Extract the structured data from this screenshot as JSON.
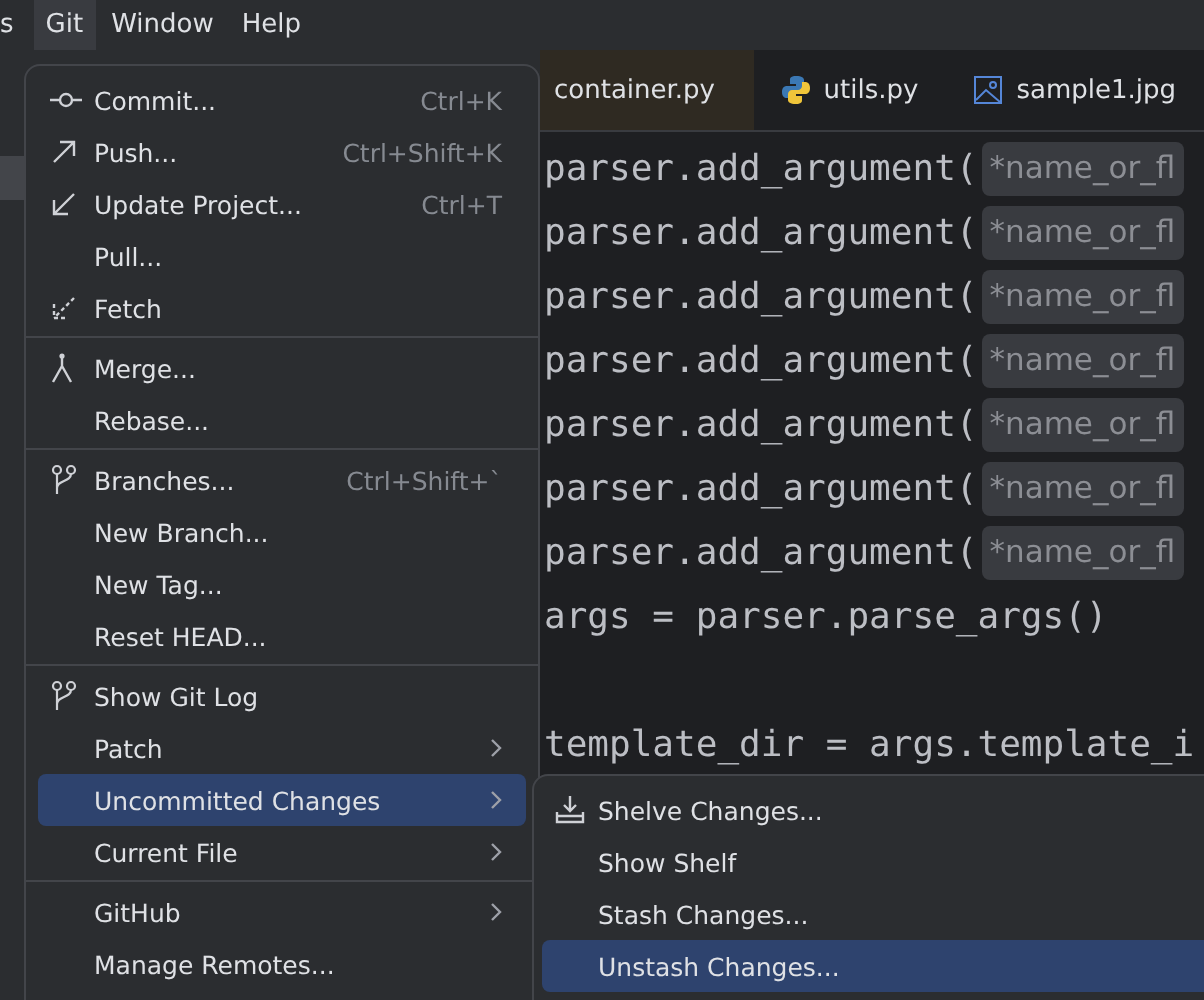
{
  "menubar": [
    {
      "label": "s",
      "selected": false
    },
    {
      "label": "Git",
      "selected": true
    },
    {
      "label": "Window",
      "selected": false
    },
    {
      "label": "Help",
      "selected": false
    }
  ],
  "tabs": [
    {
      "label": "container.py",
      "selected": true
    },
    {
      "label": "utils.py",
      "selected": false
    },
    {
      "label": "sample1.jpg",
      "selected": false
    }
  ],
  "code_blocks": [
    [
      {
        "code": "parser.add_argument(",
        "hint": "*name_or_fl"
      },
      {
        "code": "parser.add_argument(",
        "hint": "*name_or_fl"
      },
      {
        "code": "parser.add_argument(",
        "hint": "*name_or_fl"
      },
      {
        "code": "parser.add_argument(",
        "hint": "*name_or_fl"
      },
      {
        "code": "parser.add_argument(",
        "hint": "*name_or_fl"
      },
      {
        "code": "parser.add_argument(",
        "hint": "*name_or_fl"
      },
      {
        "code": "parser.add_argument(",
        "hint": "*name_or_fl"
      },
      {
        "code": "args = parser.parse_args()"
      }
    ],
    [
      {
        "code": "template_dir = args.template_i"
      }
    ]
  ],
  "git_menu": {
    "groups": [
      [
        {
          "label": "Commit...",
          "shortcut": "Ctrl+K",
          "submenu": false,
          "selected": false
        },
        {
          "label": "Push...",
          "shortcut": "Ctrl+Shift+K",
          "submenu": false,
          "selected": false
        },
        {
          "label": "Update Project...",
          "shortcut": "Ctrl+T",
          "submenu": false,
          "selected": false
        },
        {
          "label": "Pull...",
          "submenu": false,
          "selected": false
        },
        {
          "label": "Fetch",
          "submenu": false,
          "selected": false
        }
      ],
      [
        {
          "label": "Merge...",
          "submenu": false,
          "selected": false
        },
        {
          "label": "Rebase...",
          "submenu": false,
          "selected": false
        }
      ],
      [
        {
          "label": "Branches...",
          "shortcut": "Ctrl+Shift+`",
          "submenu": false,
          "selected": false
        },
        {
          "label": "New Branch...",
          "submenu": false,
          "selected": false
        },
        {
          "label": "New Tag...",
          "submenu": false,
          "selected": false
        },
        {
          "label": "Reset HEAD...",
          "submenu": false,
          "selected": false
        }
      ],
      [
        {
          "label": "Show Git Log",
          "submenu": false,
          "selected": false
        },
        {
          "label": "Patch",
          "submenu": true,
          "selected": false
        },
        {
          "label": "Uncommitted Changes",
          "submenu": true,
          "selected": true
        },
        {
          "label": "Current File",
          "submenu": true,
          "selected": false
        }
      ],
      [
        {
          "label": "GitHub",
          "submenu": true,
          "selected": false
        },
        {
          "label": "Manage Remotes...",
          "submenu": false,
          "selected": false
        }
      ]
    ]
  },
  "uncommitted_submenu": {
    "items": [
      {
        "label": "Shelve Changes...",
        "selected": false
      },
      {
        "label": "Show Shelf",
        "selected": false
      },
      {
        "label": "Stash Changes...",
        "selected": false
      },
      {
        "label": "Unstash Changes...",
        "selected": true
      }
    ]
  }
}
